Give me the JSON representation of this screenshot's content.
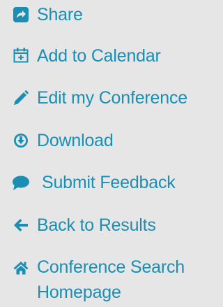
{
  "menu": {
    "items": [
      {
        "label": "Share",
        "icon": "share-icon"
      },
      {
        "label": "Add to Calendar",
        "icon": "calendar-add-icon"
      },
      {
        "label": "Edit my Conference",
        "icon": "pencil-icon"
      },
      {
        "label": "Download",
        "icon": "download-icon"
      },
      {
        "label": "Submit Feedback",
        "icon": "speech-bubble-icon"
      },
      {
        "label": "Back to Results",
        "icon": "arrow-left-icon"
      },
      {
        "label": "Conference Search Homepage",
        "icon": "home-icon"
      }
    ]
  },
  "colors": {
    "background": "#e6e6e6",
    "accent": "#1a8fb3"
  }
}
